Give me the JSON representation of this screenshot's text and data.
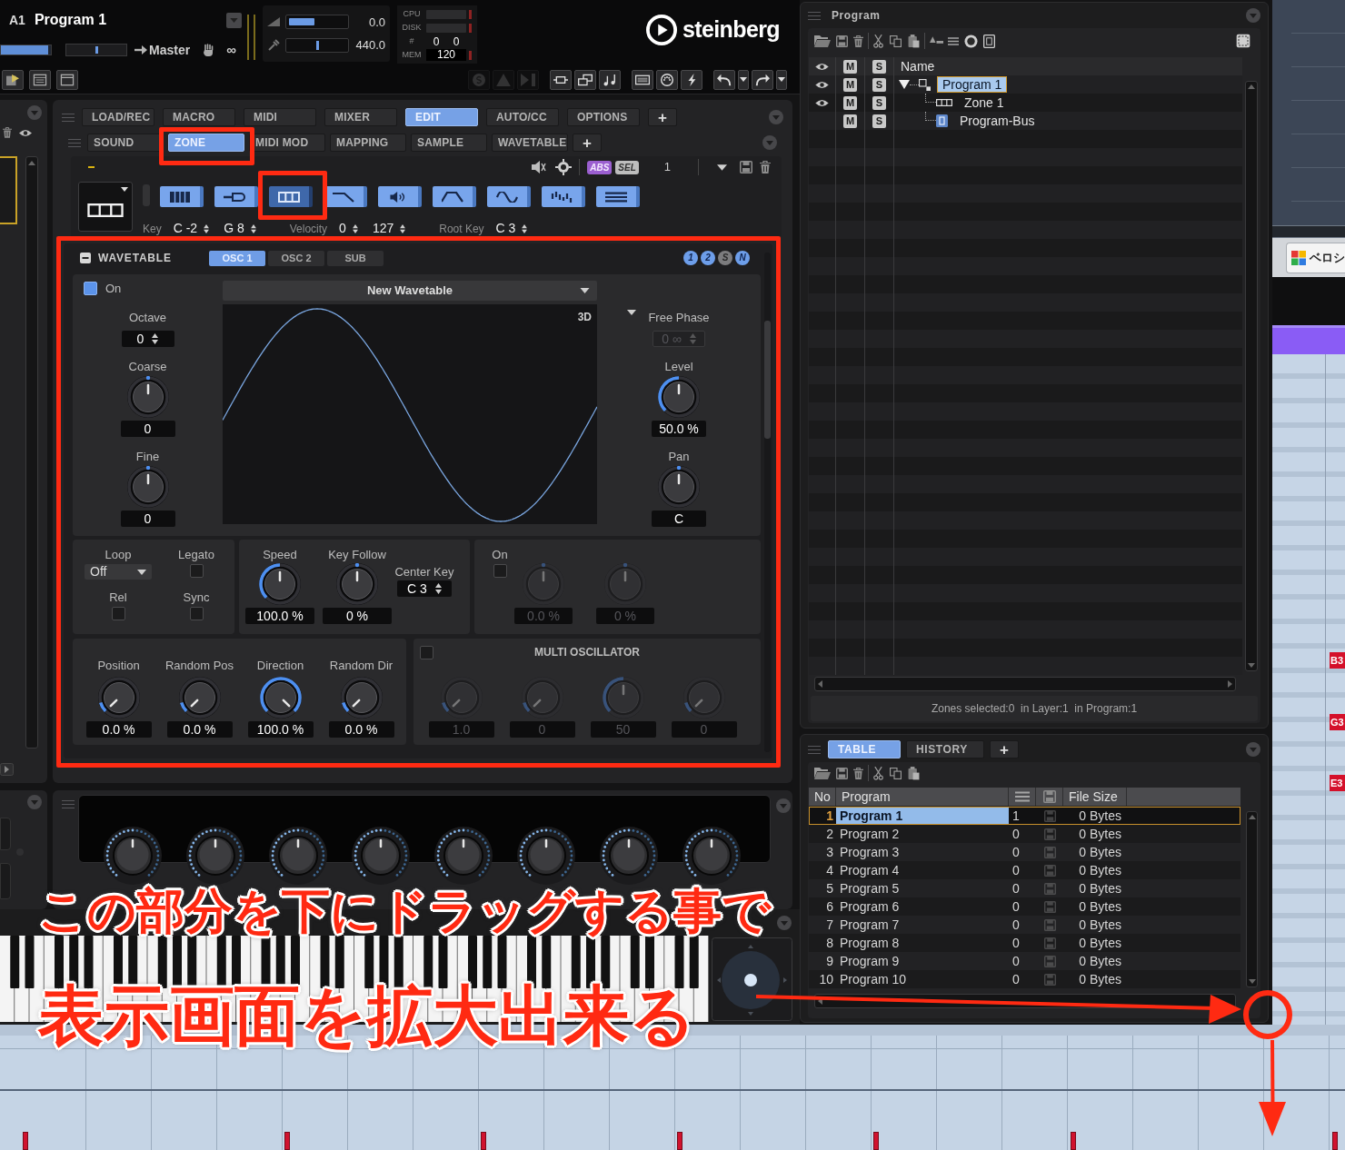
{
  "top_bar": {
    "slot": "A1",
    "program": "Program 1",
    "fader": {
      "level": 0.95
    },
    "pan": {
      "level": 0.5
    },
    "output": "Master",
    "link": "∞",
    "volume": {
      "value": "0.0",
      "level": 0.45
    },
    "tune": {
      "value": "440.0",
      "level": 0.5
    },
    "performance": [
      {
        "label": "CPU",
        "kind": "meter"
      },
      {
        "label": "DISK",
        "kind": "meter"
      },
      {
        "label": "#",
        "kind": "pair",
        "values": [
          "0",
          "0"
        ]
      },
      {
        "label": "MEM",
        "kind": "value",
        "value": "120"
      }
    ],
    "logo": "steinberg",
    "left_tools": [
      {
        "kind": "load"
      },
      {
        "kind": "layout"
      },
      {
        "kind": "window"
      }
    ],
    "right_tool_groups": [
      {
        "tools": [
          {
            "kind": "solo",
            "disabled": true
          },
          {
            "kind": "warning",
            "disabled": true
          },
          {
            "kind": "export",
            "disabled": true
          }
        ]
      },
      {
        "tools": [
          {
            "kind": "zone",
            "disabled": false
          },
          {
            "kind": "layer",
            "disabled": false
          },
          {
            "kind": "notes",
            "disabled": false
          }
        ]
      },
      {
        "tools": [
          {
            "kind": "ram",
            "disabled": false
          },
          {
            "kind": "midi",
            "disabled": false
          },
          {
            "kind": "flash",
            "disabled": false
          }
        ]
      },
      {
        "tools": [
          {
            "kind": "undo",
            "disabled": false
          },
          {
            "kind": "menu",
            "disabled": false
          },
          {
            "kind": "redo",
            "disabled": false
          },
          {
            "kind": "menu",
            "disabled": false
          }
        ]
      }
    ]
  },
  "main_tabs": {
    "items": [
      {
        "label": "LOAD/REC",
        "selected": false
      },
      {
        "label": "MACRO",
        "selected": false
      },
      {
        "label": "MIDI",
        "selected": false
      },
      {
        "label": "MIXER",
        "selected": false
      },
      {
        "label": "EDIT",
        "selected": true
      },
      {
        "label": "AUTO/CC",
        "selected": false
      },
      {
        "label": "OPTIONS",
        "selected": false
      }
    ],
    "add": "+"
  },
  "sub_tabs": {
    "items": [
      {
        "label": "SOUND",
        "selected": false
      },
      {
        "label": "ZONE",
        "selected": true
      },
      {
        "label": "MIDI MOD",
        "selected": false
      },
      {
        "label": "MAPPING",
        "selected": false
      },
      {
        "label": "SAMPLE",
        "selected": false
      },
      {
        "label": "WAVETABLE",
        "selected": false
      }
    ],
    "add": "+"
  },
  "zone_toolbar": {
    "toggles": [
      {
        "label": "ABS",
        "on": true
      },
      {
        "label": "SEL",
        "on": false
      }
    ],
    "count": "1"
  },
  "zone_types": [
    {
      "kind": "keys",
      "selected": false
    },
    {
      "kind": "sample",
      "selected": false
    },
    {
      "kind": "zone",
      "selected": true
    },
    {
      "kind": "filter",
      "selected": false
    },
    {
      "kind": "amp",
      "selected": false
    },
    {
      "kind": "envelope",
      "selected": false
    },
    {
      "kind": "lfo",
      "selected": false
    },
    {
      "kind": "steps",
      "selected": false
    },
    {
      "kind": "list",
      "selected": false
    }
  ],
  "ranges": [
    {
      "label": "Key",
      "values": [
        "C -2",
        "G 8"
      ]
    },
    {
      "label": "Velocity",
      "values": [
        "0",
        "127"
      ]
    },
    {
      "label": "Root Key",
      "values": [
        "C 3"
      ]
    }
  ],
  "wavetable": {
    "title": "WAVETABLE",
    "tabs": [
      {
        "label": "OSC 1",
        "selected": true
      },
      {
        "label": "OSC 2",
        "selected": false
      },
      {
        "label": "SUB",
        "selected": false
      }
    ],
    "badges": [
      {
        "label": "1",
        "on": true
      },
      {
        "label": "2",
        "on": true
      },
      {
        "label": "S",
        "on": false
      },
      {
        "label": "N",
        "on": true
      }
    ],
    "enable": {
      "label": "On",
      "checked": true
    },
    "wave_name": "New Wavetable",
    "view": "3D",
    "left": [
      {
        "label": "Octave",
        "kind": "spin",
        "value": "0",
        "disabled": false
      },
      {
        "label": "Coarse",
        "kind": "knob",
        "disabled": false,
        "knob": {
          "level": 0.5,
          "bipolar": true,
          "reading": "0"
        }
      },
      {
        "label": "Fine",
        "kind": "knob",
        "disabled": false,
        "knob": {
          "level": 0.5,
          "bipolar": true,
          "reading": "0"
        }
      }
    ],
    "right": [
      {
        "label": "Free Phase",
        "kind": "spin",
        "value": "0 ∞",
        "disabled": true,
        "menu": true
      },
      {
        "label": "Level",
        "kind": "knob",
        "disabled": false,
        "knob": {
          "level": 0.5,
          "bipolar": false,
          "reading": "50.0 %"
        }
      },
      {
        "label": "Pan",
        "kind": "knob",
        "disabled": false,
        "knob": {
          "level": 0.5,
          "bipolar": true,
          "reading": "C"
        }
      }
    ],
    "playback": [
      {
        "label": "Loop",
        "kind": "dropdown",
        "value": "Off"
      },
      {
        "label": "Legato",
        "kind": "check",
        "checked": false
      },
      {
        "label": "Rel",
        "kind": "check",
        "checked": false
      },
      {
        "label": "Sync",
        "kind": "check",
        "checked": false
      }
    ],
    "speed": [
      {
        "label": "Speed",
        "kind": "knob",
        "knob": {
          "level": 0.5,
          "bipolar": false,
          "reading": "100.0 %"
        }
      },
      {
        "label": "Key Follow",
        "kind": "knob",
        "knob": {
          "level": 0.5,
          "bipolar": true,
          "reading": "0 %"
        }
      },
      {
        "label": "Center Key",
        "kind": "spin",
        "value": "C 3"
      }
    ],
    "formant": {
      "enable": {
        "label": "On",
        "checked": false
      },
      "knobs": [
        {
          "value": "0.0 %",
          "level": 0.5,
          "bipolar": true,
          "disabled": true
        },
        {
          "value": "0 %",
          "level": 0.5,
          "bipolar": true,
          "disabled": true
        }
      ]
    },
    "position": [
      {
        "label": "Position",
        "knob": {
          "level": 0,
          "bipolar": false,
          "reading": "0.0 %"
        }
      },
      {
        "label": "Random Pos",
        "knob": {
          "level": 0,
          "bipolar": false,
          "reading": "0.0 %"
        }
      },
      {
        "label": "Direction",
        "knob": {
          "level": 1,
          "bipolar": false,
          "reading": "100.0 %"
        }
      },
      {
        "label": "Random Dir",
        "knob": {
          "level": 0,
          "bipolar": false,
          "reading": "0.0 %"
        }
      }
    ],
    "multi_oscillator": {
      "title": "MULTI OSCILLATOR",
      "checked": false,
      "knobs": [
        {
          "value": "1.0",
          "level": 0,
          "disabled": true
        },
        {
          "value": "0",
          "level": 0,
          "disabled": true
        },
        {
          "value": "50",
          "level": 0.5,
          "disabled": true
        },
        {
          "value": "0",
          "level": 0,
          "disabled": true
        }
      ]
    }
  },
  "macro_knobs": [
    {
      "level": 0.5
    },
    {
      "level": 0.5
    },
    {
      "level": 0.5
    },
    {
      "level": 0.5
    },
    {
      "level": 0.5
    },
    {
      "level": 0.5
    },
    {
      "level": 0.5
    },
    {
      "level": 0.5
    }
  ],
  "program_panel": {
    "title": "Program",
    "header": {
      "mute": "M",
      "solo": "S",
      "name": "Name"
    },
    "tree": [
      {
        "name": "Program 1",
        "kind": "program",
        "selected": true,
        "expanded": true,
        "eye": true,
        "mute": "M",
        "solo": "S",
        "children": [
          {
            "name": "Zone 1",
            "kind": "zone",
            "selected": false,
            "eye": true,
            "mute": "M",
            "solo": "S"
          },
          {
            "name": "Program-Bus",
            "kind": "bus",
            "selected": false,
            "eye": false,
            "mute": "M",
            "solo": "S"
          }
        ]
      }
    ],
    "status": "Zones selected:0  in Layer:1  in Program:1"
  },
  "table_panel": {
    "tabs": [
      {
        "label": "TABLE",
        "selected": true
      },
      {
        "label": "HISTORY",
        "selected": false
      }
    ],
    "add": "+",
    "columns": [
      {
        "kind": "text",
        "label": "No"
      },
      {
        "kind": "text",
        "label": "Program"
      },
      {
        "kind": "list"
      },
      {
        "kind": "save"
      },
      {
        "kind": "text",
        "label": "File Size"
      }
    ],
    "rows": [
      {
        "no": "1",
        "program": "Program 1",
        "column_3": "1",
        "file_size": "0 Bytes",
        "selected": true
      },
      {
        "no": "2",
        "program": "Program 2",
        "column_3": "0",
        "file_size": "0 Bytes",
        "selected": false
      },
      {
        "no": "3",
        "program": "Program 3",
        "column_3": "0",
        "file_size": "0 Bytes",
        "selected": false
      },
      {
        "no": "4",
        "program": "Program 4",
        "column_3": "0",
        "file_size": "0 Bytes",
        "selected": false
      },
      {
        "no": "5",
        "program": "Program 5",
        "column_3": "0",
        "file_size": "0 Bytes",
        "selected": false
      },
      {
        "no": "6",
        "program": "Program 6",
        "column_3": "0",
        "file_size": "0 Bytes",
        "selected": false
      },
      {
        "no": "7",
        "program": "Program 7",
        "column_3": "0",
        "file_size": "0 Bytes",
        "selected": false
      },
      {
        "no": "8",
        "program": "Program 8",
        "column_3": "0",
        "file_size": "0 Bytes",
        "selected": false
      },
      {
        "no": "9",
        "program": "Program 9",
        "column_3": "0",
        "file_size": "0 Bytes",
        "selected": false
      },
      {
        "no": "10",
        "program": "Program 10",
        "column_3": "0",
        "file_size": "0 Bytes",
        "selected": false
      }
    ]
  },
  "daw": {
    "button": "ベロシ",
    "note_labels": [
      "B3",
      "G3",
      "E3"
    ]
  },
  "annotation": {
    "lines": [
      "この部分を下にドラッグする事で",
      "表示画面を拡大出来る"
    ]
  }
}
